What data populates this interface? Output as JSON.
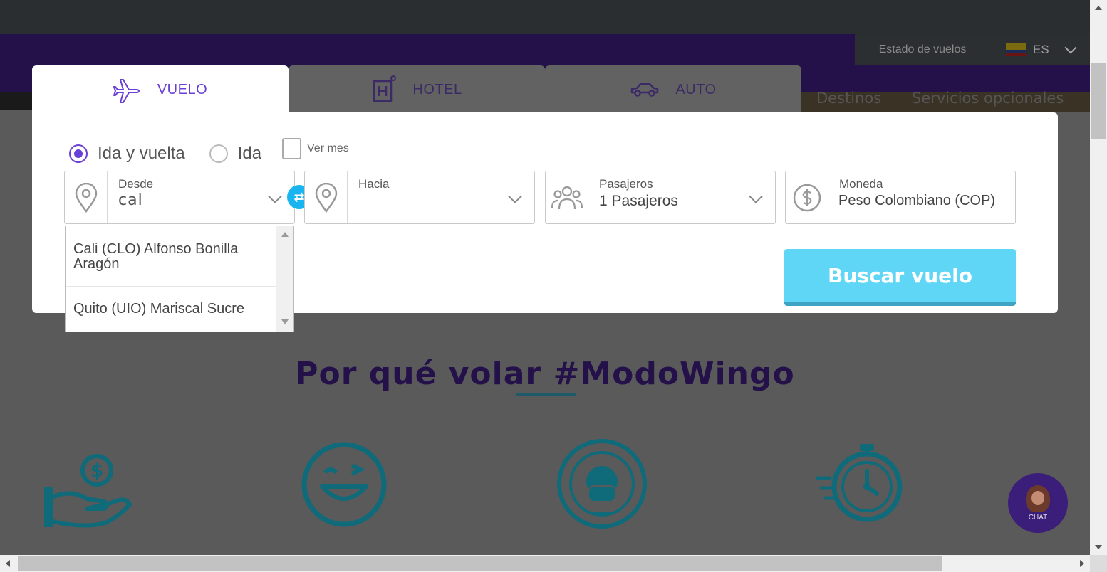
{
  "header": {
    "flight_status_label": "Estado de vuelos",
    "language_code": "ES",
    "nav_links": [
      "Destinos",
      "Servicios opcionales"
    ]
  },
  "tabs": [
    {
      "label": "VUELO",
      "icon": "plane-icon",
      "active": true
    },
    {
      "label": "HOTEL",
      "icon": "hotel-icon",
      "active": false
    },
    {
      "label": "AUTO",
      "icon": "car-icon",
      "active": false
    }
  ],
  "trip_type": {
    "options": [
      "Ida y vuelta",
      "Ida"
    ],
    "selected": "Ida y vuelta",
    "month_checkbox_label": "Ver mes",
    "month_checked": false
  },
  "fields": {
    "from": {
      "label": "Desde",
      "value": "cal"
    },
    "to": {
      "label": "Hacia",
      "value": ""
    },
    "passengers": {
      "label": "Pasajeros",
      "value": "1 Pasajeros"
    },
    "currency": {
      "label": "Moneda",
      "value": "Peso Colombiano (COP)"
    }
  },
  "autocomplete": {
    "items": [
      "Cali (CLO) Alfonso Bonilla Aragón",
      "Quito (UIO) Mariscal Sucre"
    ]
  },
  "search_button_label": "Buscar vuelo",
  "section": {
    "title": "Por qué volar #ModoWingo",
    "features": [
      "money-hand-icon",
      "wink-smile-icon",
      "safe-flight-badge-icon",
      "fast-stopwatch-icon"
    ]
  },
  "chat": {
    "label": "CHAT"
  },
  "colors": {
    "brand_purple": "#6a3fd6",
    "header_purple": "#24114a",
    "accent_cyan": "#5fd6f5",
    "swap_blue": "#18b5f0",
    "feature_teal": "#0f6a7a"
  }
}
